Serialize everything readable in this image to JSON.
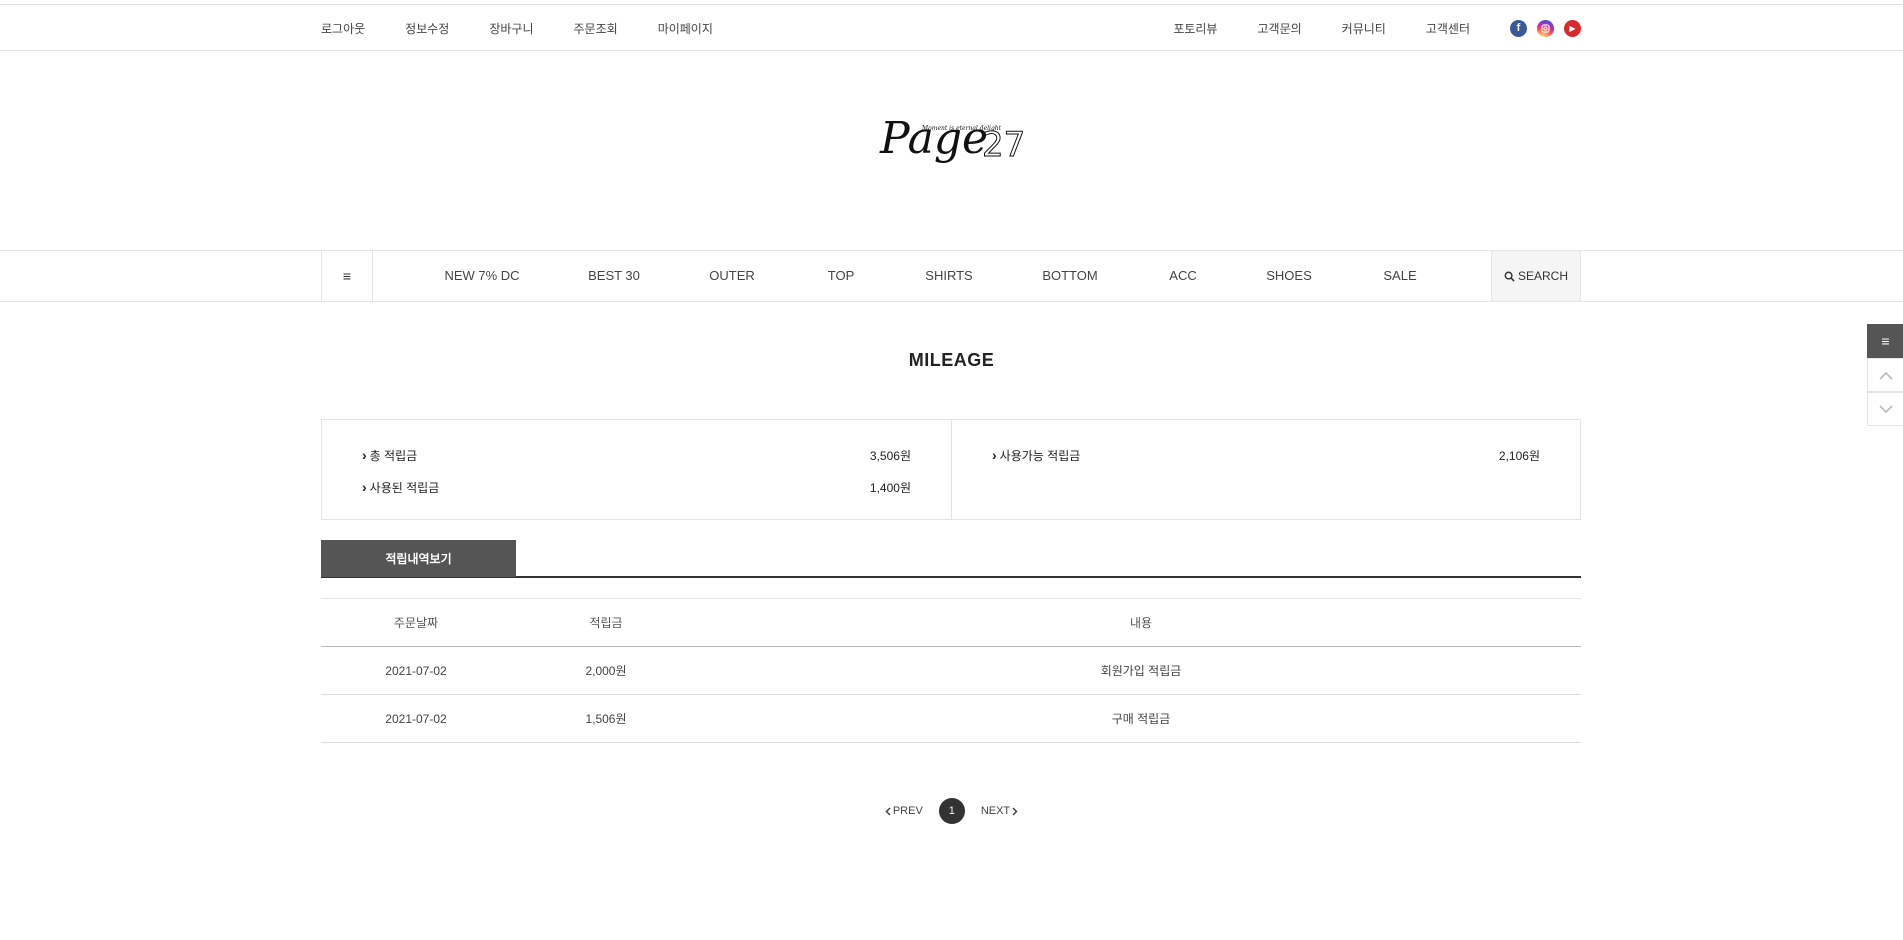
{
  "topbar": {
    "left_links": [
      "로그아웃",
      "정보수정",
      "장바구니",
      "주문조회",
      "마이페이지"
    ],
    "right_links": [
      "포토리뷰",
      "고객문의",
      "커뮤니티",
      "고객센터"
    ],
    "sns": [
      "facebook-icon",
      "instagram-icon",
      "youtube-icon"
    ]
  },
  "logo": {
    "main": "Page",
    "number": "27",
    "tagline": "Moment is eternal delight"
  },
  "gnb": {
    "items": [
      "NEW 7% DC",
      "BEST 30",
      "OUTER",
      "TOP",
      "SHIRTS",
      "BOTTOM",
      "ACC",
      "SHOES",
      "SALE"
    ],
    "search_label": "SEARCH"
  },
  "page_title": "MILEAGE",
  "summary": {
    "total_label": "총 적립금",
    "total_value": "3,506원",
    "used_label": "사용된 적립금",
    "used_value": "1,400원",
    "available_label": "사용가능 적립금",
    "available_value": "2,106원"
  },
  "tab": {
    "label": "적립내역보기"
  },
  "table": {
    "headers": [
      "주문날짜",
      "적립금",
      "내용"
    ],
    "rows": [
      [
        "2021-07-02",
        "2,000원",
        "회원가입 적립금"
      ],
      [
        "2021-07-02",
        "1,506원",
        "구매 적립금"
      ]
    ]
  },
  "paging": {
    "prev": "PREV",
    "current": "1",
    "next": "NEXT"
  },
  "colors": {
    "tab_bg": "#555555",
    "page_active": "#333333",
    "facebook": "#3b5998",
    "youtube": "#d82a2a"
  }
}
